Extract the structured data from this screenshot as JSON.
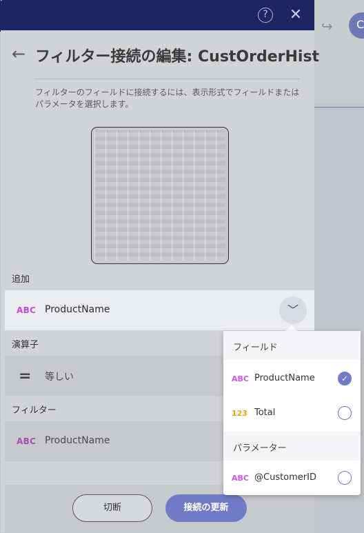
{
  "background": {
    "redo_icon": "↪",
    "account_initial": "C"
  },
  "dialog": {
    "help_icon": "?",
    "close_icon": "✕",
    "back_icon": "←",
    "title": "フィルター接続の編集: CustOrderHist",
    "description": "フィルターのフィールドに接続するには、表示形式でフィールドまたはパラメータを選択します。"
  },
  "add_section": {
    "label": "追加",
    "type_badge": "ABC",
    "value": "ProductName",
    "toggle_icon": "﹀"
  },
  "operator_section": {
    "label": "演算子",
    "icon": "=",
    "value": "等しい"
  },
  "filter_section": {
    "label": "フィルター",
    "type_badge": "ABC",
    "value": "ProductName"
  },
  "footer": {
    "disconnect_label": "切断",
    "update_label": "接続の更新"
  },
  "dropdown": {
    "fields_header": "フィールド",
    "fields": [
      {
        "type": "ABC",
        "label": "ProductName",
        "selected": true
      },
      {
        "type": "123",
        "label": "Total",
        "selected": false
      }
    ],
    "params_header": "パラメーター",
    "params": [
      {
        "type": "ABC",
        "label": "@CustomerID",
        "selected": false
      }
    ],
    "check_glyph": "✓"
  },
  "colors": {
    "header_bg": "#1d2562",
    "accent": "#6f7bc6",
    "text_badge": "#d054e2",
    "number_badge": "#f0a21b"
  }
}
